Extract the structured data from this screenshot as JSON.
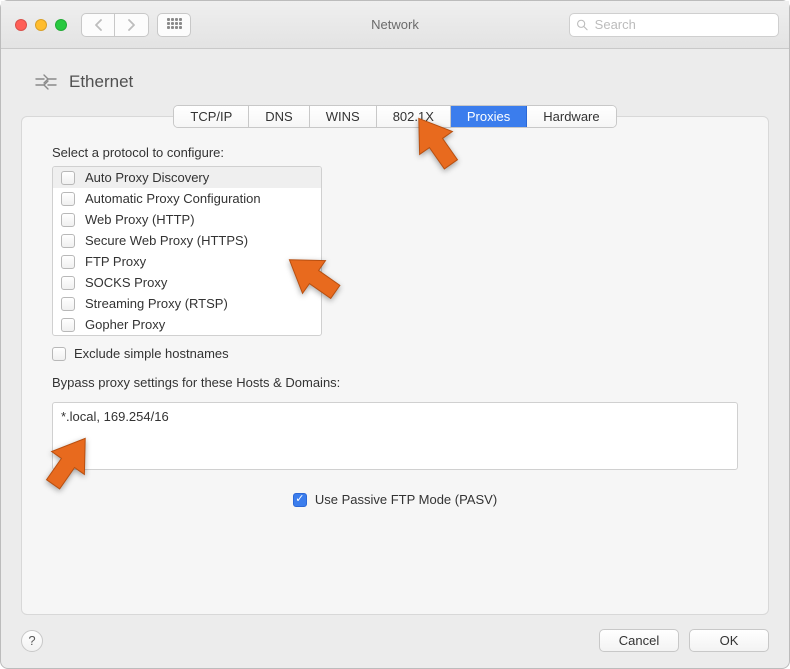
{
  "window": {
    "title": "Network",
    "search_placeholder": "Search"
  },
  "header": {
    "interface_name": "Ethernet"
  },
  "tabs": [
    {
      "label": "TCP/IP",
      "active": false
    },
    {
      "label": "DNS",
      "active": false
    },
    {
      "label": "WINS",
      "active": false
    },
    {
      "label": "802.1X",
      "active": false
    },
    {
      "label": "Proxies",
      "active": true
    },
    {
      "label": "Hardware",
      "active": false
    }
  ],
  "proxies": {
    "select_label": "Select a protocol to configure:",
    "protocols": [
      {
        "label": "Auto Proxy Discovery",
        "checked": false,
        "selected": true
      },
      {
        "label": "Automatic Proxy Configuration",
        "checked": false,
        "selected": false
      },
      {
        "label": "Web Proxy (HTTP)",
        "checked": false,
        "selected": false
      },
      {
        "label": "Secure Web Proxy (HTTPS)",
        "checked": false,
        "selected": false
      },
      {
        "label": "FTP Proxy",
        "checked": false,
        "selected": false
      },
      {
        "label": "SOCKS Proxy",
        "checked": false,
        "selected": false
      },
      {
        "label": "Streaming Proxy (RTSP)",
        "checked": false,
        "selected": false
      },
      {
        "label": "Gopher Proxy",
        "checked": false,
        "selected": false
      }
    ],
    "exclude_simple_label": "Exclude simple hostnames",
    "exclude_simple_checked": false,
    "bypass_label": "Bypass proxy settings for these Hosts & Domains:",
    "bypass_value": "*.local, 169.254/16",
    "pasv_label": "Use Passive FTP Mode (PASV)",
    "pasv_checked": true
  },
  "footer": {
    "help_label": "?",
    "cancel_label": "Cancel",
    "ok_label": "OK"
  }
}
